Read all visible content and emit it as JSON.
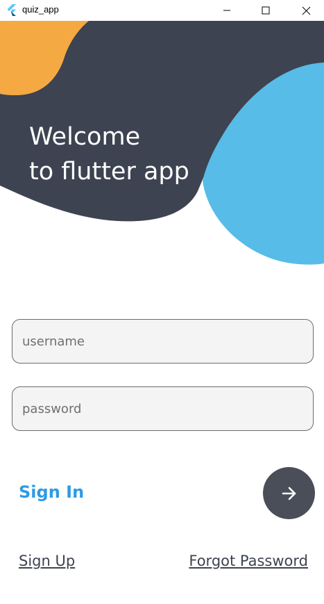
{
  "window": {
    "title": "quiz_app",
    "app_icon": "flutter-logo-icon",
    "controls": [
      "minimize-icon",
      "maximize-icon",
      "close-icon"
    ]
  },
  "header": {
    "welcome_line1": "Welcome",
    "welcome_line2": "to flutter app",
    "colors": {
      "dark": "#3d4350",
      "orange": "#f4a942",
      "blue": "#57bce7"
    }
  },
  "form": {
    "username": {
      "value": "",
      "placeholder": "username"
    },
    "password": {
      "value": "",
      "placeholder": "password"
    }
  },
  "sign_in": {
    "label": "Sign In",
    "label_color": "#2e9be6",
    "button_icon": "arrow-right-icon",
    "button_color": "#4a4e58"
  },
  "links": {
    "sign_up": "Sign Up",
    "forgot_password": "Forgot Password"
  }
}
